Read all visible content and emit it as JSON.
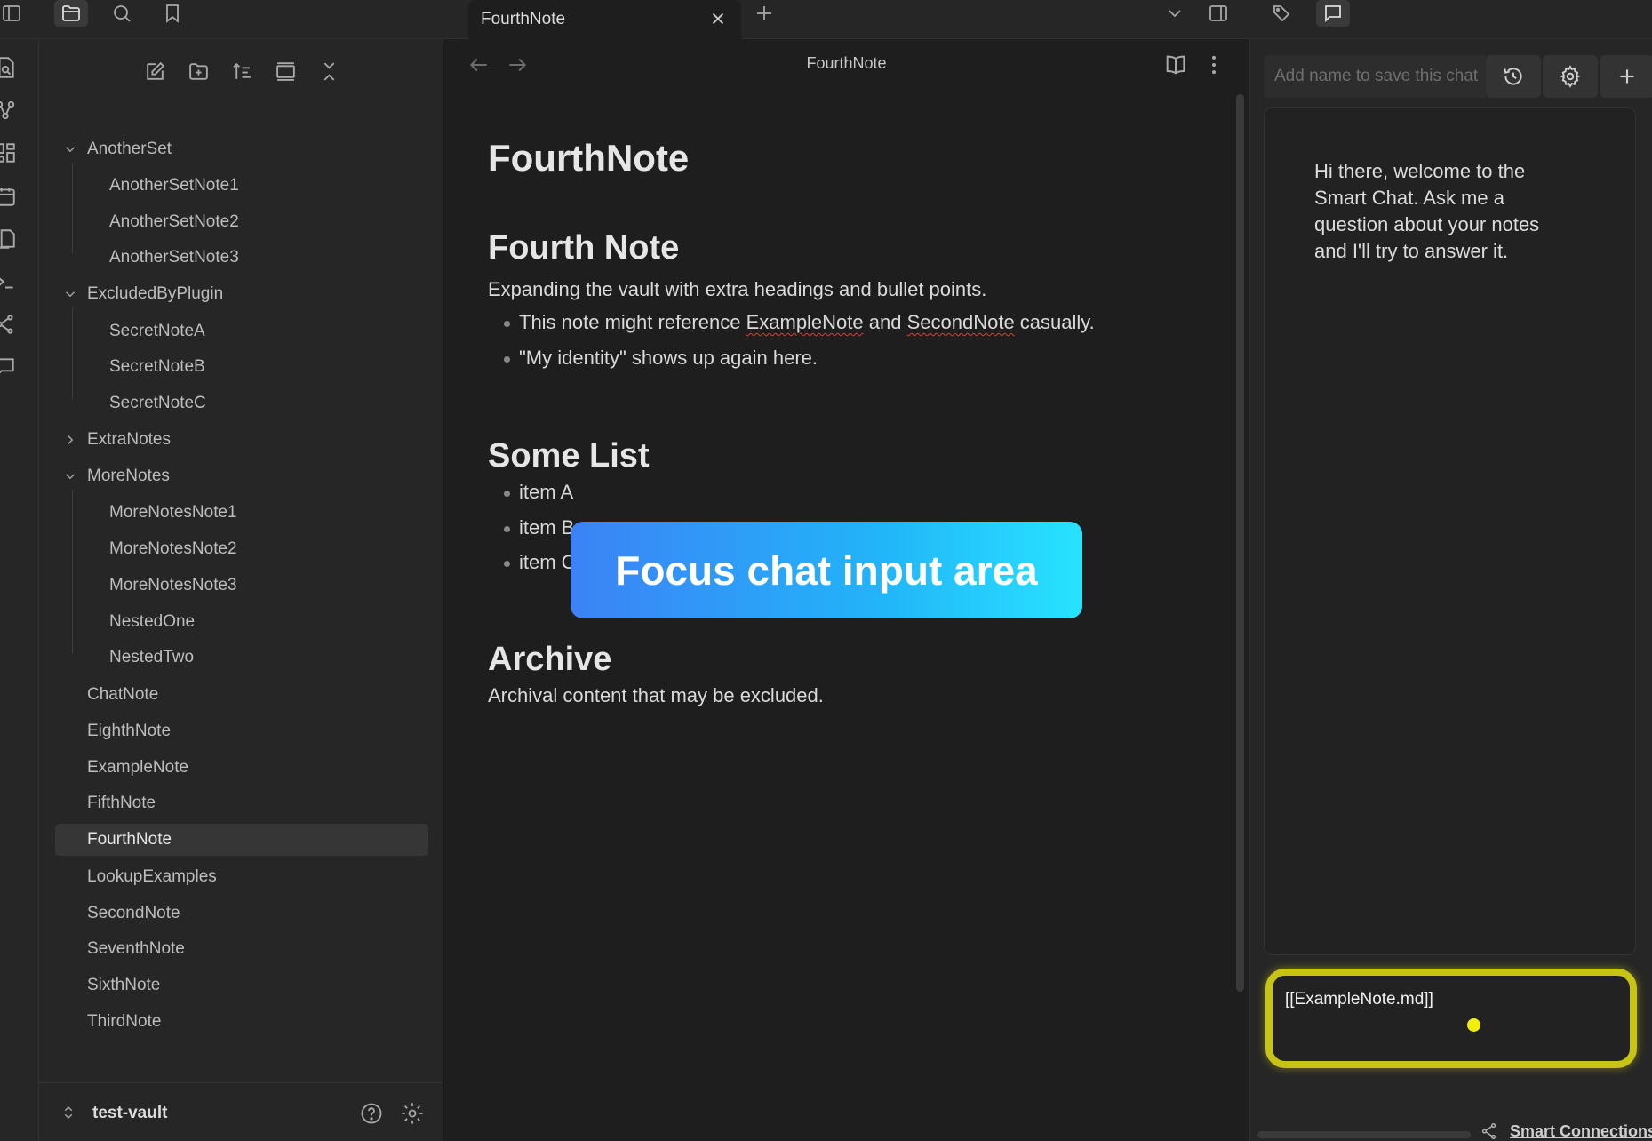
{
  "tab": {
    "title": "FourthNote"
  },
  "explorer": {
    "tree": [
      {
        "label": "AnotherSet",
        "type": "folder",
        "expanded": true
      },
      {
        "label": "AnotherSetNote1",
        "type": "file"
      },
      {
        "label": "AnotherSetNote2",
        "type": "file"
      },
      {
        "label": "AnotherSetNote3",
        "type": "file"
      },
      {
        "label": "ExcludedByPlugin",
        "type": "folder",
        "expanded": true
      },
      {
        "label": "SecretNoteA",
        "type": "file"
      },
      {
        "label": "SecretNoteB",
        "type": "file"
      },
      {
        "label": "SecretNoteC",
        "type": "file"
      },
      {
        "label": "ExtraNotes",
        "type": "folder",
        "expanded": false
      },
      {
        "label": "MoreNotes",
        "type": "folder",
        "expanded": true
      },
      {
        "label": "MoreNotesNote1",
        "type": "file"
      },
      {
        "label": "MoreNotesNote2",
        "type": "file"
      },
      {
        "label": "MoreNotesNote3",
        "type": "file"
      },
      {
        "label": "NestedOne",
        "type": "file"
      },
      {
        "label": "NestedTwo",
        "type": "file"
      },
      {
        "label": "ChatNote",
        "type": "file"
      },
      {
        "label": "EighthNote",
        "type": "file"
      },
      {
        "label": "ExampleNote",
        "type": "file"
      },
      {
        "label": "FifthNote",
        "type": "file"
      },
      {
        "label": "FourthNote",
        "type": "file",
        "selected": true
      },
      {
        "label": "LookupExamples",
        "type": "file"
      },
      {
        "label": "SecondNote",
        "type": "file"
      },
      {
        "label": "SeventhNote",
        "type": "file"
      },
      {
        "label": "SixthNote",
        "type": "file"
      },
      {
        "label": "ThirdNote",
        "type": "file"
      }
    ],
    "vault_name": "test-vault"
  },
  "editor": {
    "header_title": "FourthNote",
    "inline_title": "FourthNote",
    "h_fourth": "Fourth Note",
    "intro": "Expanding the vault with extra headings and bullet points.",
    "bullet1_pre": "This note might reference ",
    "bullet1_link1": "ExampleNote",
    "bullet1_mid": " and ",
    "bullet1_link2": "SecondNote",
    "bullet1_post": " casually.",
    "bullet2": "\"My identity\" shows up again here.",
    "h_list": "Some List",
    "list_items": [
      "item A",
      "item B",
      "item C"
    ],
    "h_archive": "Archive",
    "archive_text": "Archival content that may be excluded."
  },
  "overlay": {
    "label": "Focus chat input area"
  },
  "chat": {
    "name_placeholder": "Add name to save this chat",
    "welcome": "Hi there, welcome to the Smart Chat. Ask me a question about your notes and I'll try to answer it.",
    "input_text": "[[ExampleNote.md]]",
    "footer_link": "Smart Connections"
  },
  "colors": {
    "highlight_ring": "#c8c417",
    "cursor_dot": "#f2ed0a",
    "overlay_gradient_start": "#3c82f6",
    "overlay_gradient_end": "#27e3ff"
  }
}
